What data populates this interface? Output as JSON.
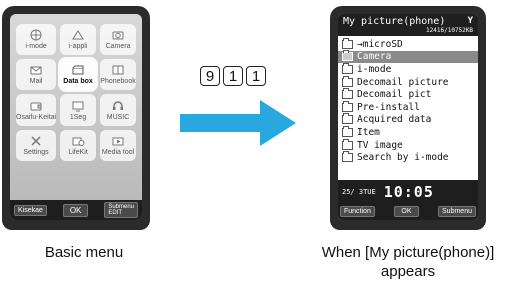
{
  "left_screen": {
    "tiles": [
      {
        "label": "i-mode",
        "icon": "globe-icon"
      },
      {
        "label": "i-appli",
        "icon": "appli-icon"
      },
      {
        "label": "Camera",
        "icon": "camera-icon"
      },
      {
        "label": "Mail",
        "icon": "mail-icon"
      },
      {
        "label": "Data box",
        "icon": "databox-icon",
        "selected": true
      },
      {
        "label": "Phonebook",
        "icon": "book-icon"
      },
      {
        "label": "Osaifu-Keitai",
        "icon": "wallet-icon"
      },
      {
        "label": "1Seg",
        "icon": "tv-icon"
      },
      {
        "label": "MUSIC",
        "icon": "headphones-icon"
      },
      {
        "label": "Settings",
        "icon": "tools-icon"
      },
      {
        "label": "LifeKit",
        "icon": "lifekit-icon"
      },
      {
        "label": "Media tool",
        "icon": "media-icon"
      }
    ],
    "softkeys": {
      "left": "Kisekae",
      "center": "OK",
      "right_top": "Submenu",
      "right_bottom": "EDIT"
    }
  },
  "keys": [
    "9",
    "1",
    "1"
  ],
  "right_screen": {
    "title": "My picture(phone)",
    "signal": "Y",
    "count": "12416/10752KB",
    "items": [
      {
        "label": "→microSD"
      },
      {
        "label": "Camera",
        "selected": true
      },
      {
        "label": "i-mode"
      },
      {
        "label": "Decomail picture"
      },
      {
        "label": "Decomail pict"
      },
      {
        "label": "Pre-install"
      },
      {
        "label": "Acquired data"
      },
      {
        "label": "Item"
      },
      {
        "label": "TV image"
      },
      {
        "label": "Search by i-mode"
      }
    ],
    "status_date": "25/ 3TUE",
    "status_time": "10:05",
    "softkeys": {
      "left": "Function",
      "center": "OK",
      "right": "Submenu"
    }
  },
  "captions": {
    "left": "Basic menu",
    "right": "When [My picture(phone)] appears"
  },
  "colors": {
    "arrow": "#29a8e0"
  }
}
